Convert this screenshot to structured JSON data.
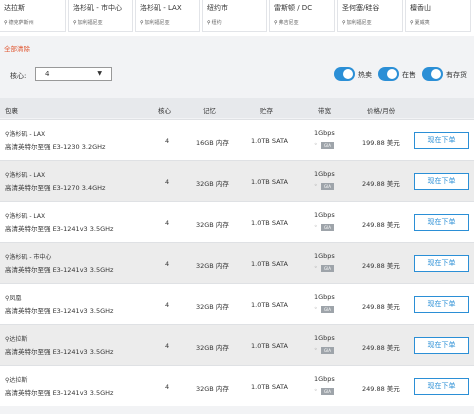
{
  "locations": [
    {
      "name": "达拉斯",
      "sub": "德克萨斯州"
    },
    {
      "name": "洛杉矶 - 市中心",
      "sub": "加利福尼亚"
    },
    {
      "name": "洛杉矶 - LAX",
      "sub": "加利福尼亚"
    },
    {
      "name": "纽约市",
      "sub": "纽约"
    },
    {
      "name": "雷斯顿 / DC",
      "sub": "弗吉尼亚"
    },
    {
      "name": "圣何塞/硅谷",
      "sub": "加利福尼亚"
    },
    {
      "name": "檀香山",
      "sub": "夏威夷"
    }
  ],
  "clear_all": "全部清除",
  "filters": {
    "cores_label": "核心:",
    "cores_value": "4",
    "toggles": [
      {
        "label": "热卖",
        "on": true
      },
      {
        "label": "在售",
        "on": true
      },
      {
        "label": "有存货",
        "on": true
      }
    ]
  },
  "table": {
    "headers": [
      "包裹",
      "核心",
      "记忆",
      "贮存",
      "带宽",
      "价格/月份"
    ],
    "rows": [
      {
        "location": "洛杉矶 - LAX",
        "cpu": "高清英特尔至强 E3-1230 3.2GHz",
        "cores": "4",
        "memory": "16GB 内存",
        "storage": "1.0TB SATA",
        "bandwidth": "1Gbps",
        "price": "199.88 美元",
        "button": "现在下单"
      },
      {
        "location": "洛杉矶 - LAX",
        "cpu": "高清英特尔至强 E3-1270 3.4GHz",
        "cores": "4",
        "memory": "32GB 内存",
        "storage": "1.0TB SATA",
        "bandwidth": "1Gbps",
        "price": "249.88 美元",
        "button": "现在下单"
      },
      {
        "location": "洛杉矶 - LAX",
        "cpu": "高清英特尔至强 E3-1241v3 3.5GHz",
        "cores": "4",
        "memory": "32GB 内存",
        "storage": "1.0TB SATA",
        "bandwidth": "1Gbps",
        "price": "249.88 美元",
        "button": "现在下单"
      },
      {
        "location": "洛杉矶 - 市中心",
        "cpu": "高清英特尔至强 E3-1241v3 3.5GHz",
        "cores": "4",
        "memory": "32GB 内存",
        "storage": "1.0TB SATA",
        "bandwidth": "1Gbps",
        "price": "249.88 美元",
        "button": "现在下单"
      },
      {
        "location": "凤凰",
        "cpu": "高清英特尔至强 E3-1241v3 3.5GHz",
        "cores": "4",
        "memory": "32GB 内存",
        "storage": "1.0TB SATA",
        "bandwidth": "1Gbps",
        "price": "249.88 美元",
        "button": "现在下单"
      },
      {
        "location": "达拉斯",
        "cpu": "高清英特尔至强 E3-1241v3 3.5GHz",
        "cores": "4",
        "memory": "32GB 内存",
        "storage": "1.0TB SATA",
        "bandwidth": "1Gbps",
        "price": "249.88 美元",
        "button": "现在下单"
      },
      {
        "location": "达拉斯",
        "cpu": "高清英特尔至强 E3-1241v3 3.5GHz",
        "cores": "4",
        "memory": "32GB 内存",
        "storage": "1.0TB SATA",
        "bandwidth": "1Gbps",
        "price": "249.88 美元",
        "button": "现在下单"
      }
    ],
    "gia_badge": "GIA"
  },
  "colors": {
    "accent": "#2b8fd6",
    "clear": "#e0552f",
    "header_bg": "#e7e9ec"
  },
  "icons": {
    "location": "map-pin-icon",
    "dropdown": "caret-down-icon",
    "network": "gia-network-icon"
  }
}
